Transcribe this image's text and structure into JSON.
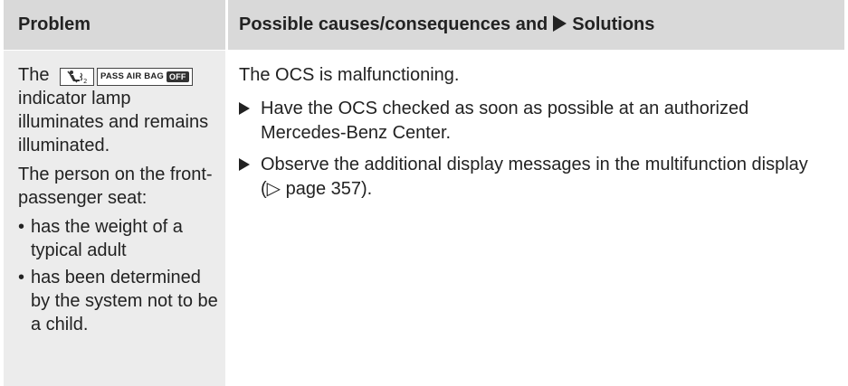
{
  "header": {
    "problem": "Problem",
    "solutions_prefix": "Possible causes/consequences and",
    "solutions_suffix": "Solutions"
  },
  "problem": {
    "line_prefix": "The",
    "indicator_text": "PASS AIR BAG",
    "indicator_badge": "OFF",
    "line_rest": "indicator lamp illuminates and remains illuminated.",
    "person_intro": "The person on the front-passenger seat:",
    "bullets": [
      "has the weight of a typical adult",
      "has been determined by the system not to be a child."
    ]
  },
  "solution": {
    "cause": "The OCS is malfunctioning.",
    "steps": [
      "Have the OCS checked as soon as possible at an authorized Mercedes-Benz Center.",
      "Observe the additional display messages in the multifunction display (▷ page 357)."
    ]
  }
}
